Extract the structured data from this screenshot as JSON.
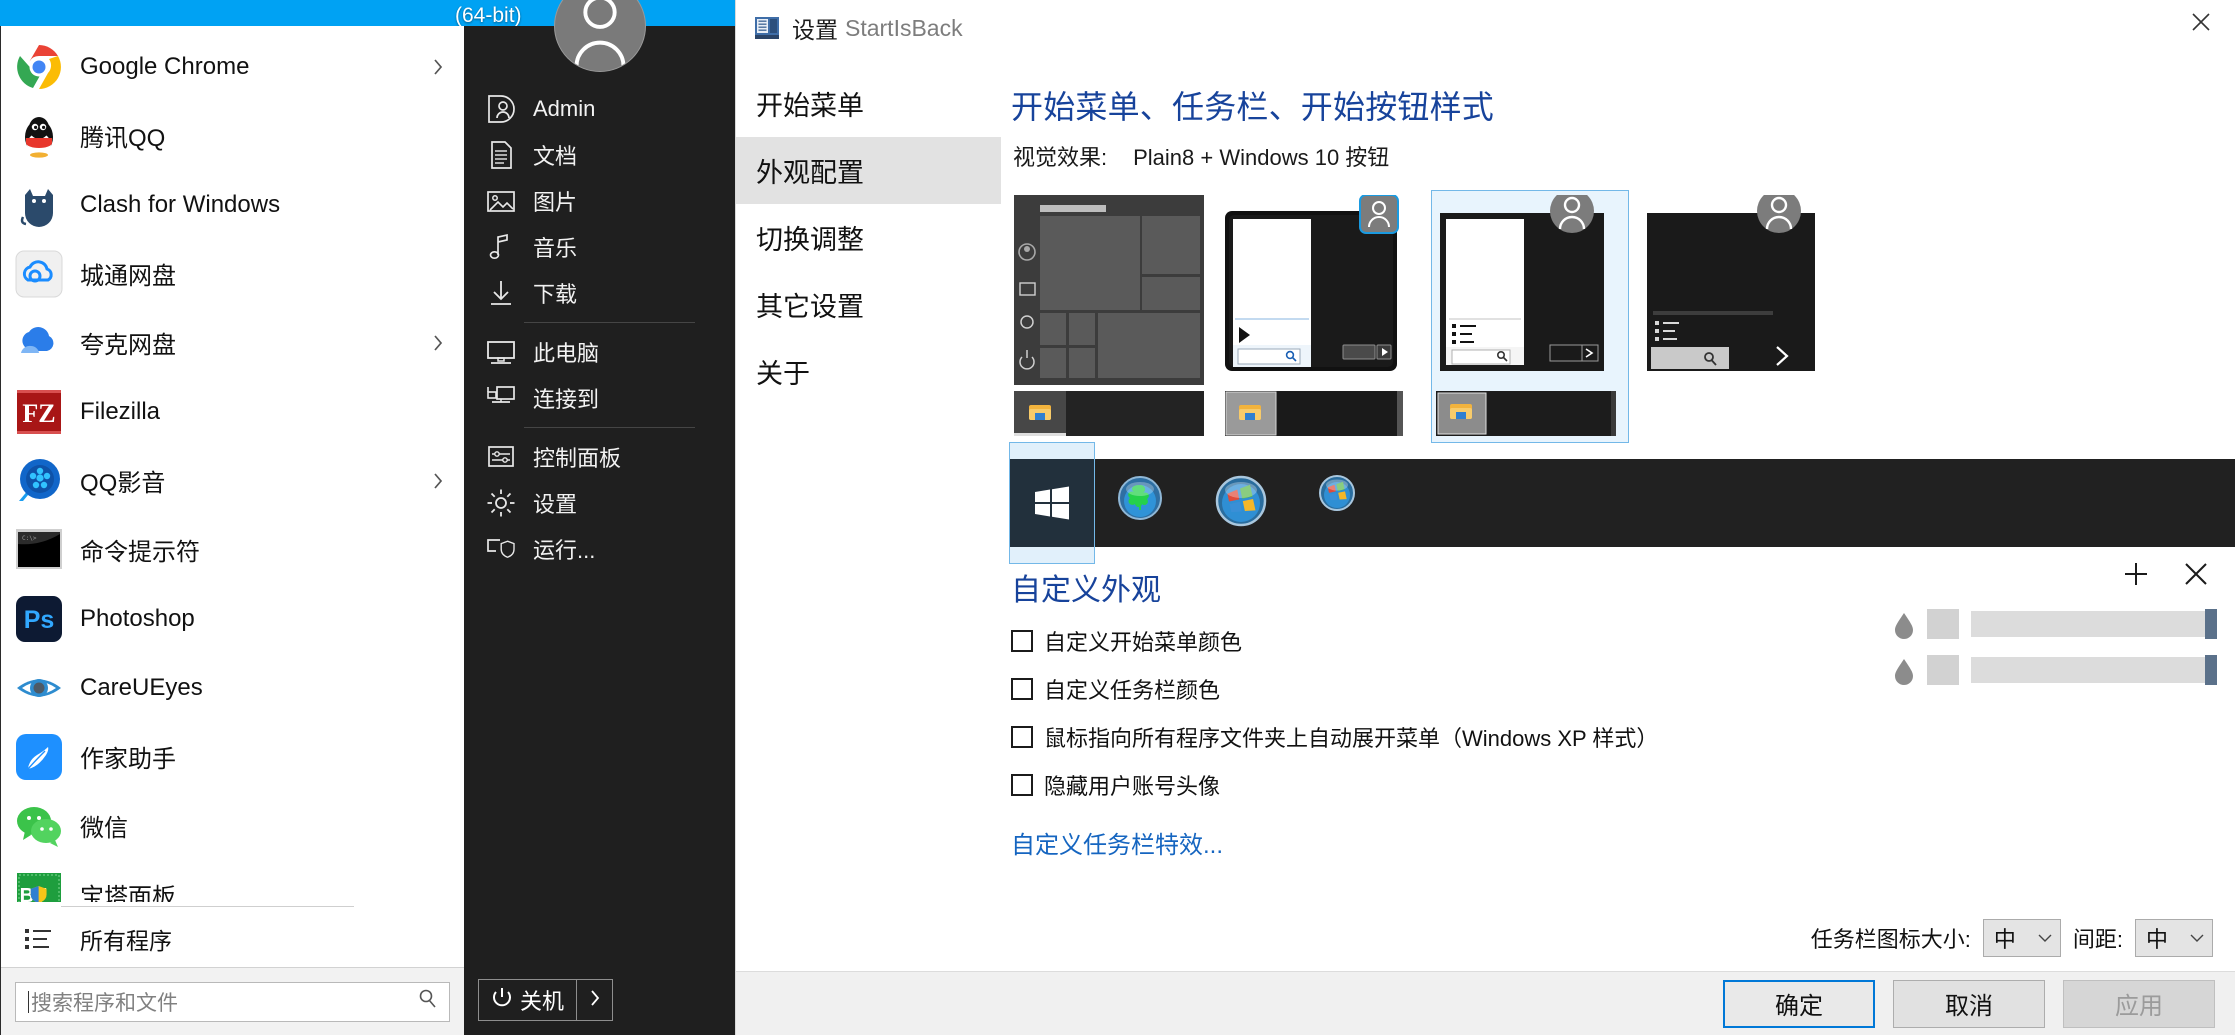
{
  "desktop": {
    "bit_label": "(64-bit)",
    "accent_color": "#00a2f3"
  },
  "start_menu": {
    "programs": [
      {
        "label": "Google Chrome",
        "icon": "chrome-icon",
        "has_submenu": true
      },
      {
        "label": "腾讯QQ",
        "icon": "qq-icon",
        "has_submenu": false
      },
      {
        "label": "Clash for Windows",
        "icon": "clash-icon",
        "has_submenu": false
      },
      {
        "label": "城通网盘",
        "icon": "ctfile-icon",
        "has_submenu": false
      },
      {
        "label": "夸克网盘",
        "icon": "quark-icon",
        "has_submenu": true
      },
      {
        "label": "Filezilla",
        "icon": "filezilla-icon",
        "has_submenu": false
      },
      {
        "label": "QQ影音",
        "icon": "qqplayer-icon",
        "has_submenu": true
      },
      {
        "label": "命令提示符",
        "icon": "cmd-icon",
        "has_submenu": false
      },
      {
        "label": "Photoshop",
        "icon": "photoshop-icon",
        "has_submenu": false
      },
      {
        "label": "CareUEyes",
        "icon": "careueyes-icon",
        "has_submenu": false
      },
      {
        "label": "作家助手",
        "icon": "writer-icon",
        "has_submenu": false
      },
      {
        "label": "微信",
        "icon": "wechat-icon",
        "has_submenu": false
      },
      {
        "label": "宝塔面板",
        "icon": "bt-panel-icon",
        "has_submenu": false
      }
    ],
    "all_programs_label": "所有程序",
    "all_programs_icon": "list-icon",
    "search_placeholder": "搜索程序和文件",
    "search_value": "",
    "search_icon": "search-icon",
    "user": {
      "name": "Admin",
      "avatar_icon": "user-avatar-icon"
    },
    "right_items": [
      {
        "label": "Admin",
        "icon": "user-card-icon",
        "separator_after": false
      },
      {
        "label": "文档",
        "icon": "document-icon",
        "separator_after": false
      },
      {
        "label": "图片",
        "icon": "picture-icon",
        "separator_after": false
      },
      {
        "label": "音乐",
        "icon": "music-note-icon",
        "separator_after": false
      },
      {
        "label": "下载",
        "icon": "download-icon",
        "separator_after": true
      },
      {
        "label": "此电脑",
        "icon": "computer-icon",
        "separator_after": false
      },
      {
        "label": "连接到",
        "icon": "connect-to-icon",
        "separator_after": true
      },
      {
        "label": "控制面板",
        "icon": "control-panel-icon",
        "separator_after": false
      },
      {
        "label": "设置",
        "icon": "gear-icon",
        "separator_after": false
      },
      {
        "label": "运行...",
        "icon": "run-shield-icon",
        "separator_after": false
      }
    ],
    "shutdown_label": "关机",
    "shutdown_icon": "power-icon",
    "shutdown_more_icon": "chevron-right-icon"
  },
  "dialog": {
    "title_main": "设置",
    "title_app": "StartIsBack",
    "title_icon": "startisback-icon",
    "close_icon": "close-icon",
    "nav": [
      {
        "label": "开始菜单",
        "active": false
      },
      {
        "label": "外观配置",
        "active": true
      },
      {
        "label": "切换调整",
        "active": false
      },
      {
        "label": "其它设置",
        "active": false
      },
      {
        "label": "关于",
        "active": false
      }
    ],
    "heading": "开始菜单、任务栏、开始按钮样式",
    "visual_effect_label": "视觉效果:",
    "visual_effect_value": "Plain8 + Windows 10 按钮",
    "style_previews": [
      {
        "name": "style-modern-tiles",
        "selected": false
      },
      {
        "name": "style-aero-glass",
        "selected": false
      },
      {
        "name": "style-plain8",
        "selected": true
      },
      {
        "name": "style-dark-flat",
        "selected": false
      }
    ],
    "taskbar_preview": {
      "start_button_icon": "windows-10-flag-icon",
      "button_options": [
        {
          "name": "orb-green-icon"
        },
        {
          "name": "orb-windows-icon"
        },
        {
          "name": "orb-small-windows-icon"
        }
      ]
    },
    "custom_section": {
      "heading": "自定义外观",
      "add_icon": "plus-icon",
      "remove_icon": "close-x-icon",
      "checkboxes": [
        {
          "label": "自定义开始菜单颜色",
          "checked": false
        },
        {
          "label": "自定义任务栏颜色",
          "checked": false
        },
        {
          "label": "鼠标指向所有程序文件夹上自动展开菜单（Windows XP 样式）",
          "checked": false
        },
        {
          "label": "隐藏用户账号头像",
          "checked": false
        }
      ],
      "link_label": "自定义任务栏特效...",
      "sliders": [
        {
          "name": "start-menu-color-slider",
          "icon": "color-drop-icon"
        },
        {
          "name": "taskbar-color-slider",
          "icon": "color-drop-icon"
        }
      ]
    },
    "bottom_controls": {
      "icon_size_label": "任务栏图标大小:",
      "icon_size_value": "中",
      "spacing_label": "间距:",
      "spacing_value": "中",
      "chevron_icon": "chevron-down-icon"
    },
    "footer": {
      "ok": "确定",
      "cancel": "取消",
      "apply": "应用",
      "apply_disabled": true
    }
  }
}
